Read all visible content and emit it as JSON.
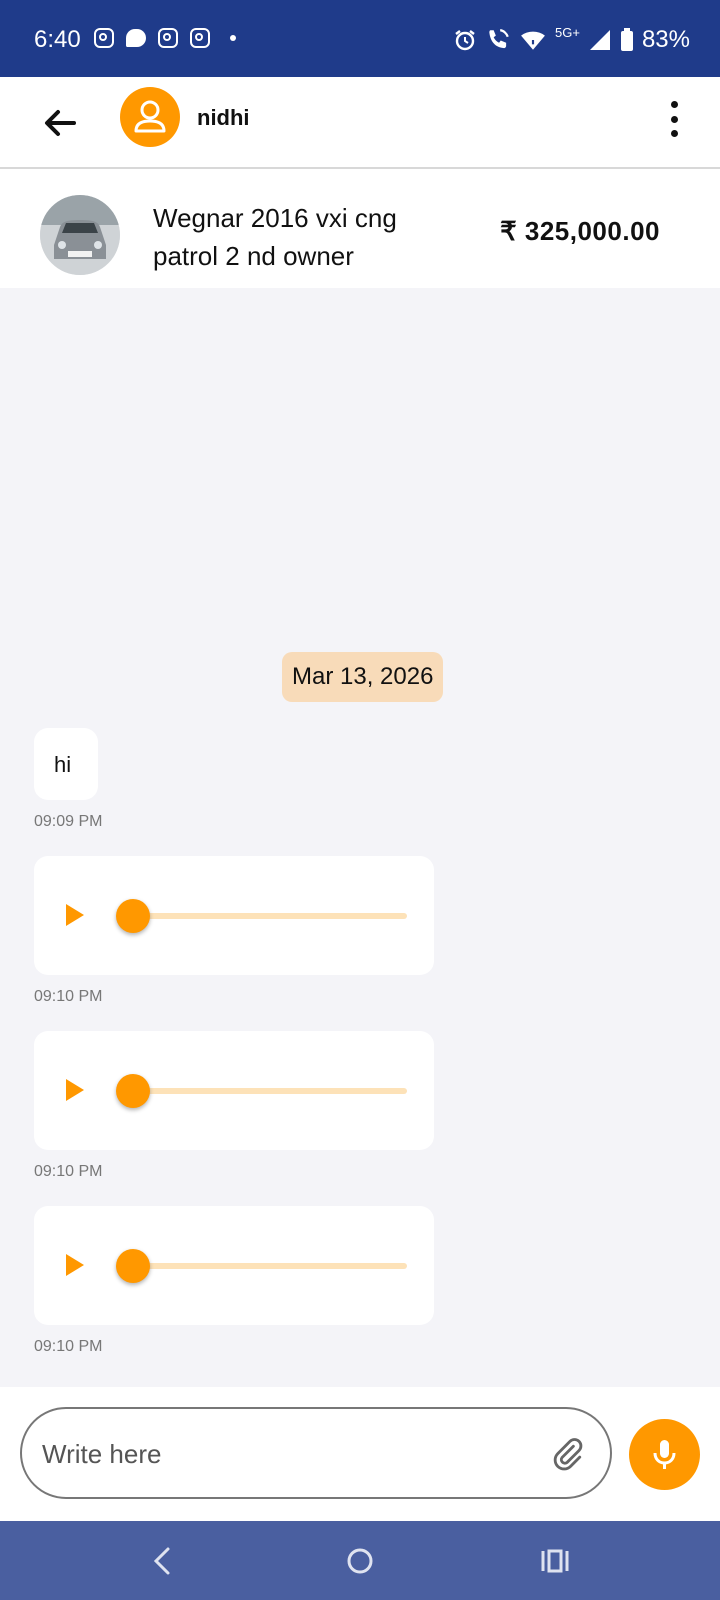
{
  "status_bar": {
    "time": "6:40",
    "network": "5G+",
    "battery": "83%"
  },
  "header": {
    "contact_name": "nidhi"
  },
  "listing": {
    "title": "Wegnar 2016 vxi cng patrol 2 nd owner",
    "price": "₹ 325,000.00"
  },
  "chat": {
    "date": "Mar 13, 2026",
    "messages": [
      {
        "type": "text",
        "text": "hi",
        "time": "09:09 PM"
      },
      {
        "type": "audio",
        "time": "09:10 PM",
        "progress": 0
      },
      {
        "type": "audio",
        "time": "09:10 PM",
        "progress": 0
      },
      {
        "type": "audio",
        "time": "09:10 PM",
        "progress": 0
      }
    ]
  },
  "composer": {
    "placeholder": "Write here"
  },
  "colors": {
    "accent": "#ff9800",
    "status_bar": "#1f3b8a",
    "nav_bar": "#4a5fa0",
    "date_chip": "#f8dbb9"
  }
}
